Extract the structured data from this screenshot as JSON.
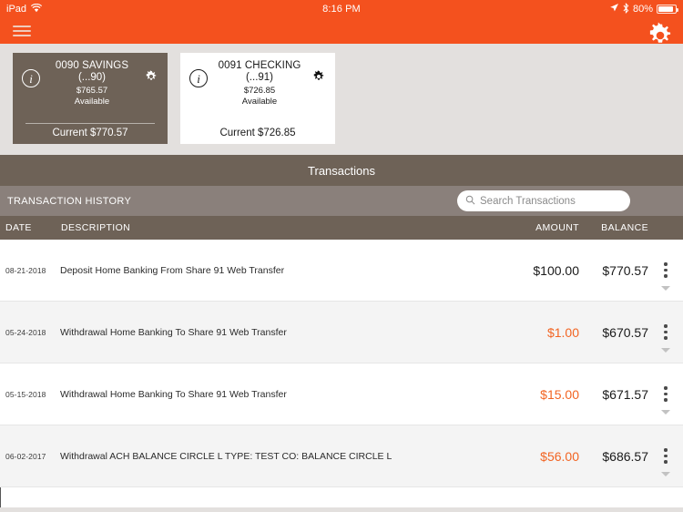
{
  "status_bar": {
    "device": "iPad",
    "wifi_icon": "wifi-icon",
    "time": "8:16 PM",
    "location_icon": "location-arrow-icon",
    "bluetooth_icon": "bluetooth-icon",
    "battery_percent": "80%",
    "battery_icon": "battery-icon"
  },
  "navbar": {
    "menu_icon": "hamburger-menu-icon",
    "settings_icon": "gear-icon",
    "background_color": "#f4511e"
  },
  "accounts": [
    {
      "name": "0090 SAVINGS",
      "mask": "(...90)",
      "available_amount": "$765.57",
      "available_label": "Available",
      "current": "Current $770.57",
      "info_icon": "info-circle-icon",
      "settings_icon": "gear-icon",
      "selected": true
    },
    {
      "name": "0091 CHECKING",
      "mask": "(...91)",
      "available_amount": "$726.85",
      "available_label": "Available",
      "current": "Current $726.85",
      "info_icon": "info-circle-icon",
      "settings_icon": "gear-icon",
      "selected": false
    }
  ],
  "transactions_panel": {
    "title": "Transactions",
    "history_label": "TRANSACTION HISTORY",
    "search": {
      "placeholder": "Search Transactions",
      "value": "",
      "icon": "search-icon"
    },
    "columns": {
      "date": "DATE",
      "description": "DESCRIPTION",
      "amount": "AMOUNT",
      "balance": "BALANCE"
    },
    "row_action_icon": "kebab-menu-icon",
    "row_expand_icon": "chevron-down-icon",
    "rows": [
      {
        "date": "08-21-2018",
        "description": "Deposit Home Banking From Share 91 Web Transfer",
        "amount": "$100.00",
        "balance": "$770.57",
        "type": "credit"
      },
      {
        "date": "05-24-2018",
        "description": "Withdrawal Home Banking To Share 91 Web Transfer",
        "amount": "$1.00",
        "balance": "$670.57",
        "type": "debit"
      },
      {
        "date": "05-15-2018",
        "description": "Withdrawal Home Banking To Share 91 Web Transfer",
        "amount": "$15.00",
        "balance": "$671.57",
        "type": "debit"
      },
      {
        "date": "06-02-2017",
        "description": "Withdrawal ACH BALANCE CIRCLE L TYPE: TEST CO: BALANCE CIRCLE L",
        "amount": "$56.00",
        "balance": "$686.57",
        "type": "debit"
      }
    ]
  },
  "theme": {
    "accent_orange": "#f4511e",
    "debit_orange": "#f26422",
    "header_brown": "#6e6257",
    "search_bar_brown": "#8a807b",
    "page_background": "#e3e0de"
  }
}
